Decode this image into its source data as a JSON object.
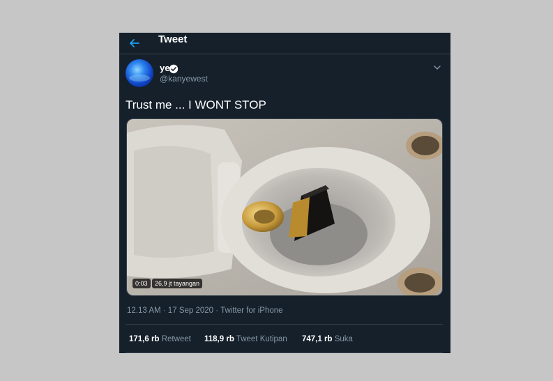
{
  "header": {
    "back_icon": "arrow-left-icon",
    "title": "Tweet"
  },
  "tweet": {
    "author": {
      "name": "ye",
      "handle": "@kanyewest",
      "verified": true
    },
    "text": "Trust me ... I WONT STOP",
    "media": {
      "duration": "0:03",
      "views": "26,9 jt tayangan"
    },
    "timestamp": "12.13 AM · 17 Sep 2020",
    "separator": " · ",
    "source": "Twitter for iPhone",
    "stats": [
      {
        "value": "171,6 rb",
        "label": "Retweet"
      },
      {
        "value": "118,9 rb",
        "label": "Tweet Kutipan"
      },
      {
        "value": "747,1 rb",
        "label": "Suka"
      }
    ]
  },
  "colors": {
    "background": "#15202b",
    "page": "#c6c6c6",
    "accent": "#1da1f2",
    "muted_text": "#8899a6",
    "border": "#38444d"
  }
}
